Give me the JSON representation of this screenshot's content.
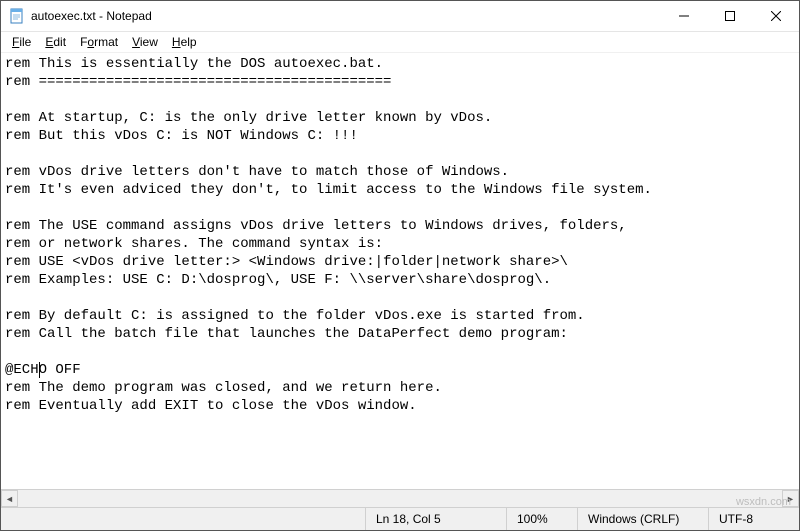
{
  "titlebar": {
    "title": "autoexec.txt - Notepad"
  },
  "menubar": {
    "file": "File",
    "edit": "Edit",
    "format": "Format",
    "view": "View",
    "help": "Help"
  },
  "editor": {
    "content": "rem This is essentially the DOS autoexec.bat.\nrem ==========================================\n\nrem At startup, C: is the only drive letter known by vDos.\nrem But this vDos C: is NOT Windows C: !!!\n\nrem vDos drive letters don't have to match those of Windows.\nrem It's even adviced they don't, to limit access to the Windows file system.\n\nrem The USE command assigns vDos drive letters to Windows drives, folders,\nrem or network shares. The command syntax is:\nrem USE <vDos drive letter:> <Windows drive:|folder|network share>\\\nrem Examples: USE C: D:\\dosprog\\, USE F: \\\\server\\share\\dosprog\\.\n\nrem By default C: is assigned to the folder vDos.exe is started from.\nrem Call the batch file that launches the DataPerfect demo program:\n\n@ECHO OFF\nrem The demo program was closed, and we return here.\nrem Eventually add EXIT to close the vDos window."
  },
  "statusbar": {
    "position": "Ln 18, Col 5",
    "zoom": "100%",
    "line_ending": "Windows (CRLF)",
    "encoding": "UTF-8"
  },
  "watermark": "wsxdn.com",
  "caret": {
    "line": 18,
    "col": 5
  }
}
